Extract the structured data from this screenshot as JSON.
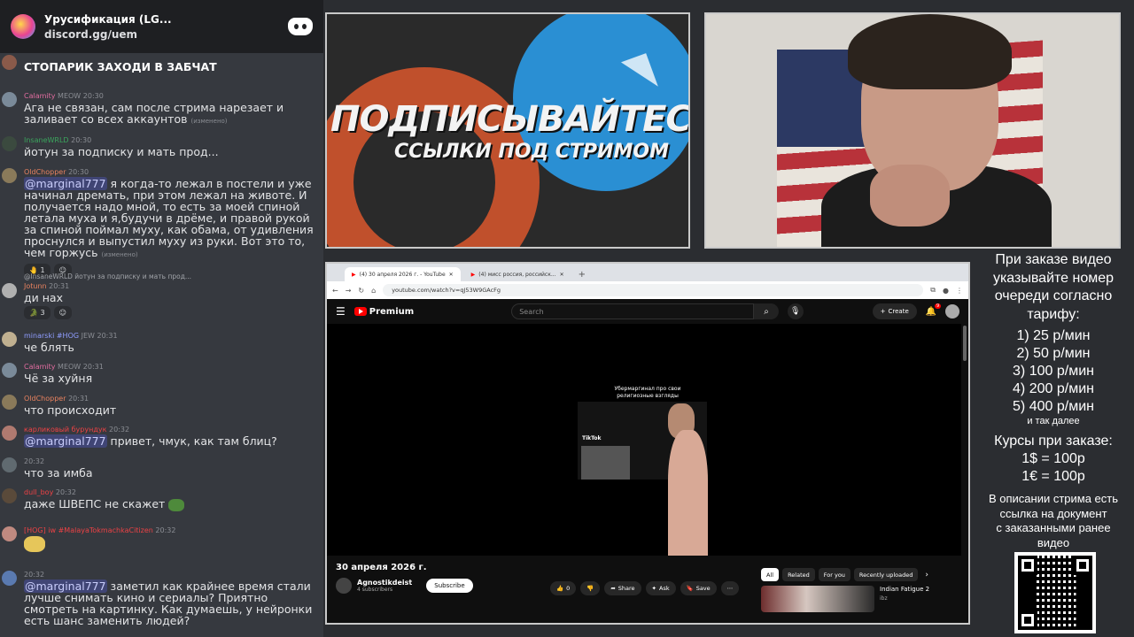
{
  "server": {
    "name": "Урусификация (LG...",
    "link": "discord.gg/uem"
  },
  "chat": {
    "pinned": "СТОПАРИК ЗАХОДИ В ЗАБЧАТ",
    "messages": [
      {
        "user": "Calamity",
        "tag": "MEOW",
        "time": "20:30",
        "text": "Ага не связан, сам после стрима нарезает и заливает со всех аккаунтов",
        "edited": "(изменено)"
      },
      {
        "user": "InsaneWRLD",
        "time": "20:30",
        "text": "йотун за подписку и мать прод..."
      },
      {
        "user": "OldChopper",
        "time": "20:30",
        "mention": "@marginal777",
        "text": " я когда-то лежал в постели и уже начинал дремать, при этом лежал на животе. И получается надо мной, то есть за моей спиной летала муха и я,будучи в дрёме, и правой рукой за спиной поймал муху, как обама, от удивления проснулся и выпустил муху из руки. Вот это то, чем горжусь",
        "edited": "(изменено)",
        "reaction_count": "1"
      },
      {
        "reply": "@InsaneWRLD йотун за подписку и мать прод...",
        "user": "Jotunn",
        "time": "20:31",
        "text": "ди нах",
        "reaction_count": "3"
      },
      {
        "user": "minarski #HOG",
        "tag": "JEW",
        "time": "20:31",
        "text": "че блять"
      },
      {
        "user": "Calamity",
        "tag": "MEOW",
        "time": "20:31",
        "text": "Чё за хуйня"
      },
      {
        "user": "OldChopper",
        "time": "20:31",
        "text": "что происходит"
      },
      {
        "user": "карликовый бурундук",
        "time": "20:32",
        "mention": "@marginal777",
        "text": " привет, чмук, как там блиц?"
      },
      {
        "user": "",
        "time": "20:32",
        "text": "что за имба"
      },
      {
        "user": "dull_boy",
        "time": "20:32",
        "text": "даже ШВЕПС не скажет"
      },
      {
        "user": "[HOG] iw #MalayaTokmachkaCitizen",
        "time": "20:32",
        "text": ""
      },
      {
        "user": "",
        "time": "20:32",
        "mention": "@marginal777",
        "text": " заметил как крайнее время стали лучше снимать кино и сериалы? Приятно смотреть на картинку. Как думаешь, у нейронки есть шанс заменить людей?"
      }
    ]
  },
  "banner": {
    "title": "ПОДПИСЫВАЙТЕСЬ",
    "subtitle": "ССЫЛКИ ПОД СТРИМОМ"
  },
  "browser": {
    "tabs": [
      "(4) 30 апреля 2026 г. - YouTube",
      "(4) мисс россия, российск..."
    ],
    "url": "youtube.com/watch?v=qJ53W9GAcFg",
    "yt": {
      "logo": "Premium",
      "search_placeholder": "Search",
      "create": "Create",
      "notif_count": "9",
      "video_caption": "Убермаргинал про свои религиозные взгляды",
      "tiktok": "TikTok",
      "video_title": "30 апреля 2026 г.",
      "channel": "Agnostikdeist",
      "subs": "4 subscribers",
      "subscribe": "Subscribe",
      "likes": "0",
      "share": "Share",
      "ask": "Ask",
      "save": "Save",
      "chips": [
        "All",
        "Related",
        "For you",
        "Recently uploaded"
      ],
      "rec_title": "Indian Fatigue 2",
      "rec_channel": "ibz"
    }
  },
  "info": {
    "head": [
      "При заказе видео",
      "указывайте номер",
      "очереди согласно",
      "тарифу:"
    ],
    "tariffs": [
      "1) 25 р/мин",
      "2) 50 р/мин",
      "3) 100 р/мин",
      "4) 200 р/мин",
      "5) 400 р/мин"
    ],
    "etc": "и так далее",
    "courses_title": "Курсы при заказе:",
    "courses": [
      "1$ = 100р",
      "1€ = 100р"
    ],
    "desc": [
      "В описании стрима есть",
      "ссылка на документ",
      "с заказанными ранее",
      "видео"
    ]
  }
}
